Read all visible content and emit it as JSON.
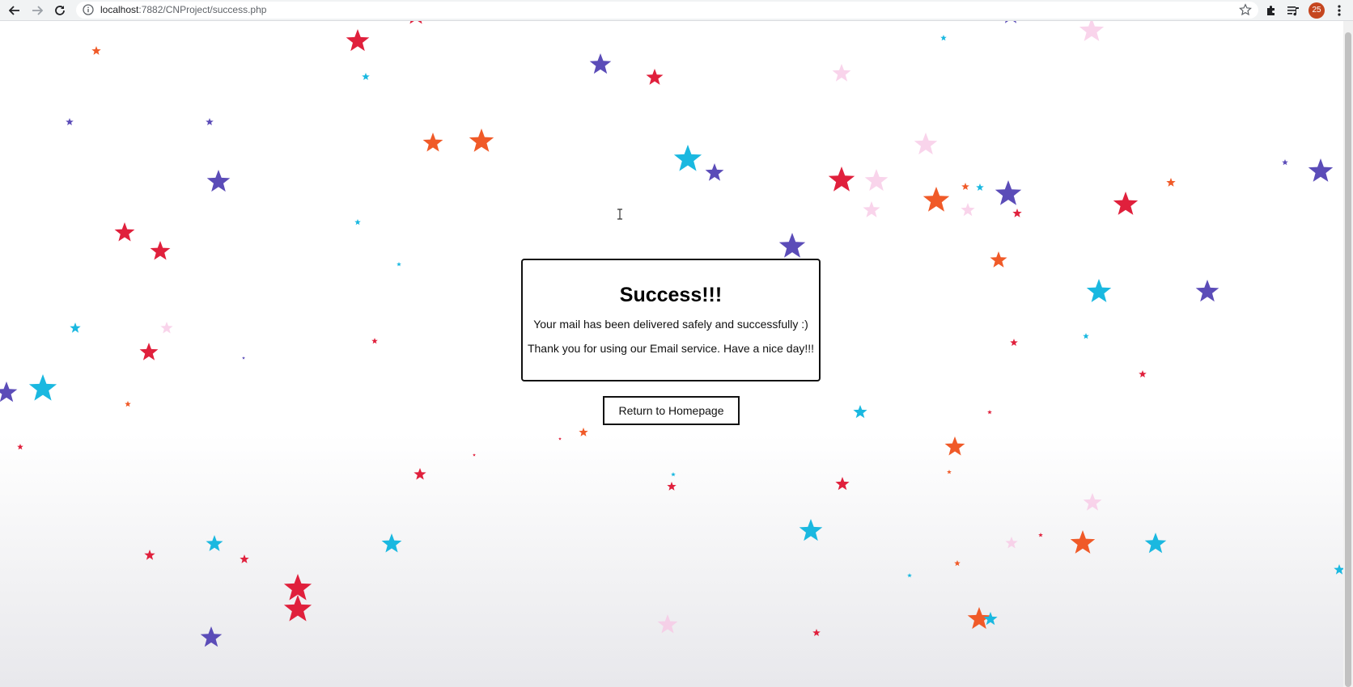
{
  "browser": {
    "url_host": "localhost",
    "url_path": ":7882/CNProject/success.php",
    "profile_badge": "25"
  },
  "card": {
    "title": "Success!!!",
    "line1": "Your mail has been delivered safely and successfully :)",
    "line2": "Thank you for using our Email service. Have a nice day!!!"
  },
  "home_button": {
    "label": "Return to Homepage"
  },
  "colors": {
    "red": "#e0203c",
    "orange": "#f05a28",
    "purple": "#5b4cb8",
    "cyan": "#1ab8e0",
    "pink": "#f7c6e4"
  }
}
